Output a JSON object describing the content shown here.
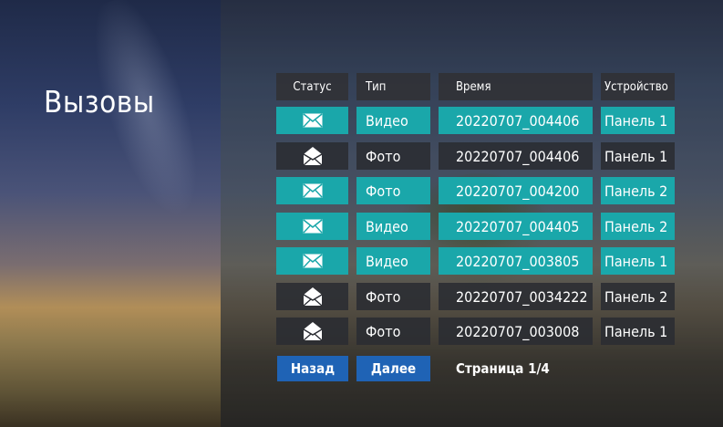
{
  "title": "Вызовы",
  "headers": [
    "Статус",
    "Тип",
    "Время",
    "Устройство"
  ],
  "rows": [
    {
      "status": "unread",
      "status_icon": "envelope-closed-icon",
      "type": "Видео",
      "time": "20220707_004406",
      "device": "Панель 1"
    },
    {
      "status": "read",
      "status_icon": "envelope-open-icon",
      "type": "Фото",
      "time": "20220707_004406",
      "device": "Панель 1"
    },
    {
      "status": "unread",
      "status_icon": "envelope-closed-icon",
      "type": "Фото",
      "time": "20220707_004200",
      "device": "Панель 2"
    },
    {
      "status": "unread",
      "status_icon": "envelope-closed-icon",
      "type": "Видео",
      "time": "20220707_004405",
      "device": "Панель 2"
    },
    {
      "status": "unread",
      "status_icon": "envelope-closed-icon",
      "type": "Видео",
      "time": "20220707_003805",
      "device": "Панель 1"
    },
    {
      "status": "read",
      "status_icon": "envelope-open-icon",
      "type": "Фото",
      "time": "20220707_0034222",
      "device": "Панель 2"
    },
    {
      "status": "read",
      "status_icon": "envelope-open-icon",
      "type": "Фото",
      "time": "20220707_003008",
      "device": "Панель 1"
    }
  ],
  "pager": {
    "back_label": "Назад",
    "next_label": "Далее",
    "page_text": "Страница 1/4"
  },
  "colors": {
    "selected_row": "#1aa7aa",
    "normal_row": "#2a2c32",
    "header": "#303034",
    "button": "#1f63b5"
  }
}
